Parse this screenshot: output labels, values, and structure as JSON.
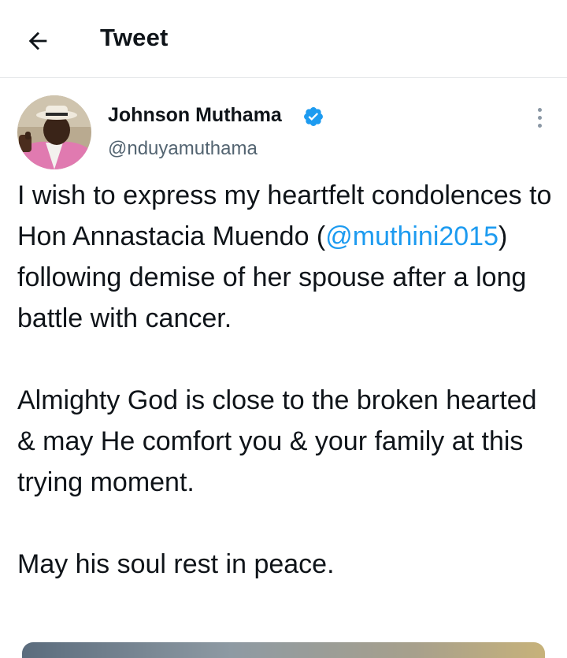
{
  "header": {
    "back_icon": "arrow-left-icon",
    "title": "Tweet"
  },
  "tweet": {
    "author": {
      "name": "Johnson Muthama",
      "handle": "@nduyamuthama",
      "verified": true,
      "verified_color": "#1d9bf0"
    },
    "more_icon": "vertical-ellipsis-icon",
    "paragraphs": [
      {
        "before": "I wish to express my heartfelt condolences to Hon Annastacia Muendo (",
        "mention": "@muthini2015",
        "after": ") following demise of her spouse after a long battle with cancer."
      },
      {
        "text": "Almighty God is close to the broken hearted & may He comfort you & your family at this trying moment."
      },
      {
        "text": "May his soul rest in peace."
      }
    ]
  },
  "colors": {
    "text": "#0f1419",
    "secondary": "#536471",
    "link": "#1d9bf0",
    "divider": "#e6e8ea"
  }
}
